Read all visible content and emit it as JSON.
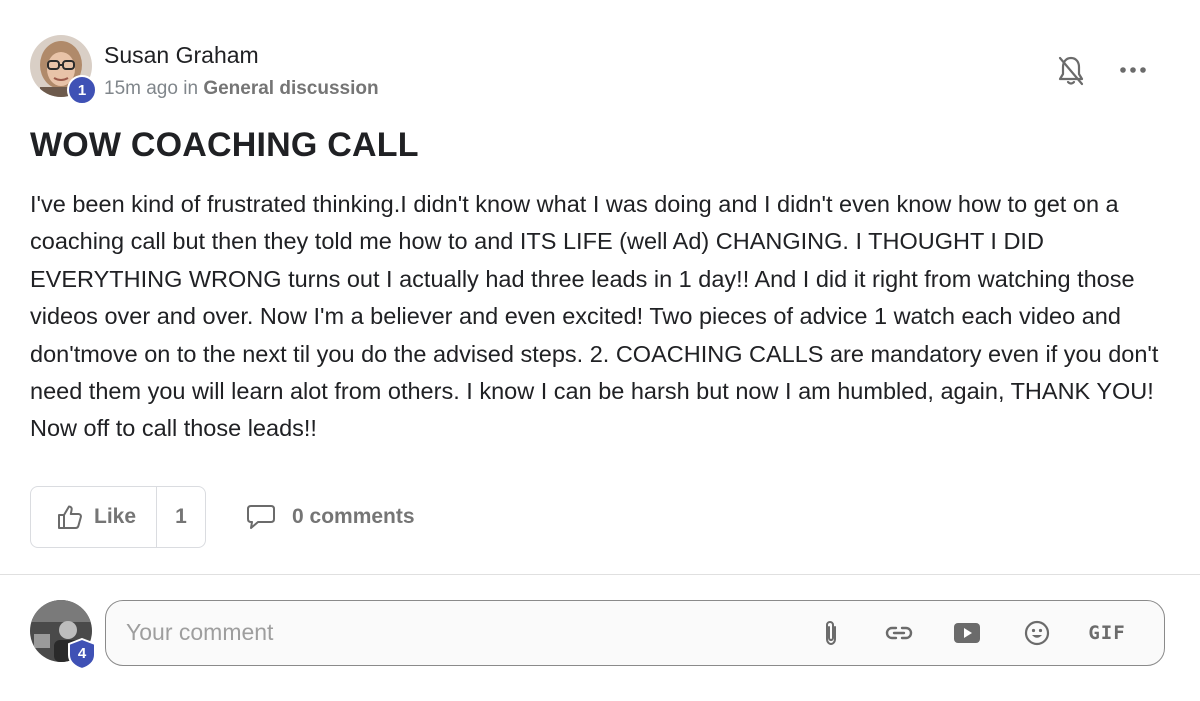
{
  "post": {
    "author": {
      "name": "Susan Graham",
      "level": "1"
    },
    "time": "15m ago",
    "in_word": "in",
    "category": "General discussion",
    "title": "WOW COACHING CALL",
    "body": "I've been kind of frustrated thinking.I didn't know what I was doing and I didn't even know how to get on a coaching call but then they told me how to and ITS LIFE (well Ad) CHANGING. I THOUGHT I DID EVERYTHING WRONG turns out I actually had three leads in 1 day!! And I did it right from watching those videos over and over. Now I'm a believer and even excited! Two pieces of advice 1 watch each video and don'tmove on to the next til you do the advised steps. 2. COACHING CALLS are mandatory even if you don't need them you will learn alot from others. I know I can be harsh but now I am humbled, again, THANK YOU! Now off to call those leads!!"
  },
  "actions": {
    "like_label": "Like",
    "like_count": "1",
    "comments_label": "0 comments"
  },
  "composer": {
    "user_level": "4",
    "placeholder": "Your comment",
    "gif_label": "GIF"
  },
  "colors": {
    "badge": "#3f51b5",
    "text": "#202124",
    "muted": "#757575"
  },
  "icons": [
    "bell-off-icon",
    "more-horizontal-icon",
    "thumbs-up-icon",
    "comment-bubble-icon",
    "paperclip-icon",
    "link-icon",
    "video-play-icon",
    "emoji-icon"
  ]
}
